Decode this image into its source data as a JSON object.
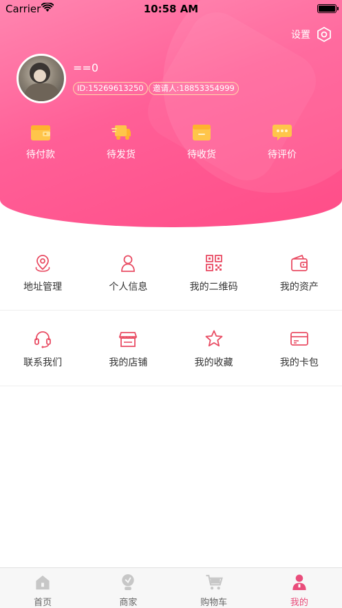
{
  "status_bar": {
    "carrier": "Carrier",
    "time": "10:58 AM"
  },
  "header": {
    "settings_label": "设置",
    "nickname": "==0",
    "id_tag": "ID:15269613250",
    "inviter_tag": "邀请人:18853354999"
  },
  "orders": [
    {
      "label": "待付款",
      "icon": "wallet-icon"
    },
    {
      "label": "待发货",
      "icon": "truck-icon"
    },
    {
      "label": "待收货",
      "icon": "box-icon"
    },
    {
      "label": "待评价",
      "icon": "comment-icon"
    }
  ],
  "menu": [
    {
      "label": "地址管理",
      "icon": "location-icon"
    },
    {
      "label": "个人信息",
      "icon": "user-icon"
    },
    {
      "label": "我的二维码",
      "icon": "qrcode-icon"
    },
    {
      "label": "我的资产",
      "icon": "wallet-icon"
    },
    {
      "label": "联系我们",
      "icon": "headset-icon"
    },
    {
      "label": "我的店铺",
      "icon": "store-icon"
    },
    {
      "label": "我的收藏",
      "icon": "star-icon"
    },
    {
      "label": "我的卡包",
      "icon": "card-icon"
    }
  ],
  "tabbar": [
    {
      "label": "首页",
      "icon": "home-icon",
      "active": false
    },
    {
      "label": "商家",
      "icon": "merchant-icon",
      "active": false
    },
    {
      "label": "购物车",
      "icon": "cart-icon",
      "active": false
    },
    {
      "label": "我的",
      "icon": "profile-icon",
      "active": true
    }
  ],
  "colors": {
    "brand_pink": "#ff4d88",
    "icon_red": "#e94d64",
    "order_icon_yellow": "#ffc54a",
    "tab_active": "#e94d7b",
    "tab_inactive": "#c7c7c7"
  }
}
